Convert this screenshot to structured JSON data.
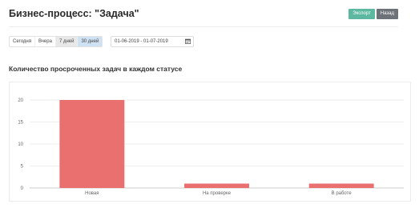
{
  "header": {
    "title": "Бизнес-процесс: \"Задача\"",
    "export_label": "Экспорт",
    "back_label": "Назад"
  },
  "period": {
    "today": "Сегодня",
    "yesterday": "Вчера",
    "week": "7 дней",
    "month": "30 дней",
    "active": "30 дней"
  },
  "date_range": {
    "value": "01-06-2019 - 01-07-2019"
  },
  "chart_section": {
    "title": "Количество просроченных задач в каждом статусе"
  },
  "colors": {
    "bar": "#ea6f6f",
    "export": "#5cb8a0",
    "back": "#6c7278"
  },
  "chart_data": {
    "type": "bar",
    "categories": [
      "Новая",
      "На проверке",
      "В работе"
    ],
    "values": [
      20,
      1,
      1
    ],
    "title": "",
    "xlabel": "",
    "ylabel": "",
    "ylim": [
      0,
      20
    ],
    "yticks": [
      0,
      5,
      10,
      15,
      20
    ],
    "grid": true
  }
}
